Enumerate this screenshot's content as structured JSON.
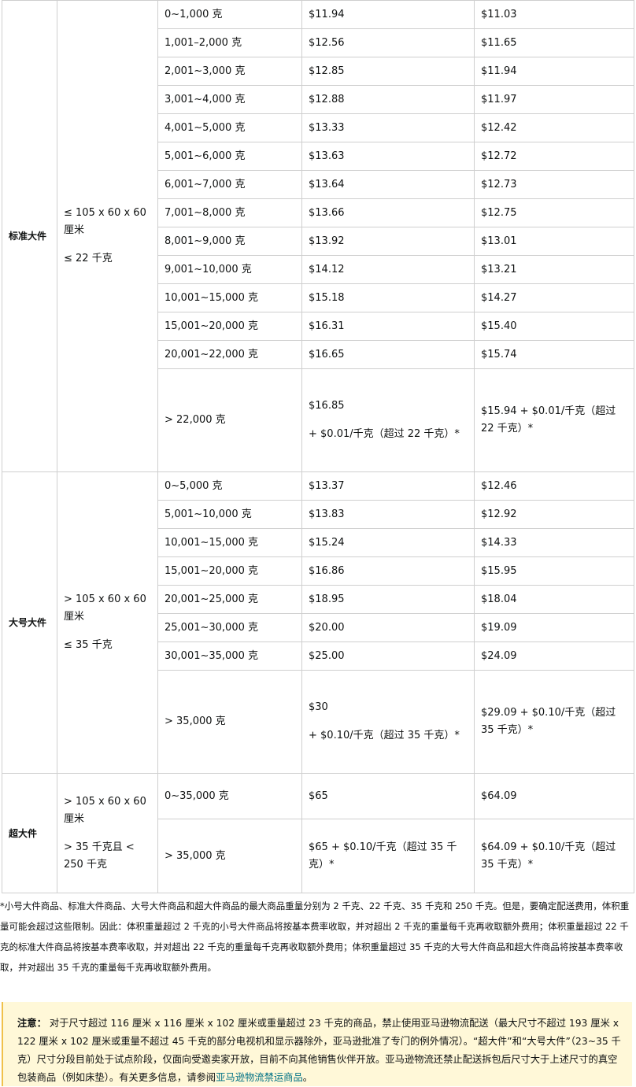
{
  "standard": {
    "tier": "标准大件",
    "dims": "≤ 105 x 60 x 60 厘米",
    "weight_limit": "≤ 22 千克",
    "rows": [
      {
        "w": "0~1,000 克",
        "a": "$11.94",
        "b": "$11.03"
      },
      {
        "w": "1,001–2,000 克",
        "a": "$12.56",
        "b": "$11.65"
      },
      {
        "w": "2,001~3,000 克",
        "a": "$12.85",
        "b": "$11.94"
      },
      {
        "w": "3,001~4,000 克",
        "a": "$12.88",
        "b": "$11.97"
      },
      {
        "w": "4,001~5,000 克",
        "a": "$13.33",
        "b": "$12.42"
      },
      {
        "w": "5,001~6,000 克",
        "a": "$13.63",
        "b": "$12.72"
      },
      {
        "w": "6,001~7,000 克",
        "a": "$13.64",
        "b": "$12.73"
      },
      {
        "w": "7,001~8,000 克",
        "a": "$13.66",
        "b": "$12.75"
      },
      {
        "w": "8,001~9,000 克",
        "a": "$13.92",
        "b": "$13.01"
      },
      {
        "w": "9,001~10,000 克",
        "a": "$14.12",
        "b": "$13.21"
      },
      {
        "w": "10,001~15,000 克",
        "a": "$15.18",
        "b": "$14.27"
      },
      {
        "w": "15,001~20,000 克",
        "a": "$16.31",
        "b": "$15.40"
      },
      {
        "w": "20,001~22,000 克",
        "a": "$16.65",
        "b": "$15.74"
      }
    ],
    "last": {
      "w": "> 22,000 克",
      "a1": "$16.85",
      "a2": "+ $0.01/千克（超过 22 千克）*",
      "b": "$15.94 + $0.01/千克（超过 22 千克）*"
    }
  },
  "large": {
    "tier": "大号大件",
    "dims": "> 105 x 60 x 60 厘米",
    "weight_limit": "≤ 35 千克",
    "rows": [
      {
        "w": "0~5,000 克",
        "a": "$13.37",
        "b": "$12.46"
      },
      {
        "w": "5,001~10,000 克",
        "a": "$13.83",
        "b": "$12.92"
      },
      {
        "w": "10,001~15,000 克",
        "a": "$15.24",
        "b": "$14.33"
      },
      {
        "w": "15,001~20,000 克",
        "a": "$16.86",
        "b": "$15.95"
      },
      {
        "w": "20,001~25,000 克",
        "a": "$18.95",
        "b": "$18.04"
      },
      {
        "w": "25,001~30,000 克",
        "a": "$20.00",
        "b": "$19.09"
      },
      {
        "w": "30,001~35,000 克",
        "a": "$25.00",
        "b": "$24.09"
      }
    ],
    "last": {
      "w": "> 35,000 克",
      "a1": "$30",
      "a2": "+ $0.10/千克（超过 35 千克）*",
      "b": "$29.09 + $0.10/千克（超过 35 千克）*"
    }
  },
  "extra": {
    "tier": "超大件",
    "dims": "> 105 x 60 x 60 厘米",
    "weight_limit": "> 35 千克且 < 250 千克",
    "rows": [
      {
        "w": "0~35,000 克",
        "a": "$65",
        "b": "$64.09"
      },
      {
        "w": "> 35,000 克",
        "a": "$65 + $0.10/千克（超过 35 千克）*",
        "b": "$64.09 + $0.10/千克（超过 35 千克）*"
      }
    ]
  },
  "footnote": "*小号大件商品、标准大件商品、大号大件商品和超大件商品的最大商品重量分别为 2 千克、22 千克、35 千克和 250 千克。但是，要确定配送费用，体积重量可能会超过这些限制。因此：体积重量超过 2 千克的小号大件商品将按基本费率收取，并对超出 2 千克的重量每千克再收取额外费用；体积重量超过 22 千克的标准大件商品将按基本费率收取，并对超出 22 千克的重量每千克再收取额外费用；体积重量超过 35 千克的大号大件商品和超大件商品将按基本费率收取，并对超出 35 千克的重量每千克再收取额外费用。",
  "note": {
    "label": "注意：",
    "text": "对于尺寸超过 116 厘米 x 116 厘米 x 102 厘米或重量超过 23 千克的商品，禁止使用亚马逊物流配送（最大尺寸不超过 193 厘米 x 122 厘米 x 102 厘米或重量不超过 45 千克的部分电视机和显示器除外，亚马逊批准了专门的例外情况）。“超大件”和“大号大件”（23~35 千克）尺寸分段目前处于试点阶段，仅面向受邀卖家开放，目前不向其他销售伙伴开放。亚马逊物流还禁止配送拆包后尺寸大于上述尺寸的真空包装商品（例如床垫）。有关更多信息，请参阅",
    "link": "亚马逊物流禁运商品",
    "end": "。"
  },
  "colors": {
    "border": "#cfcfcf",
    "note_bg": "#fff8d8",
    "link": "#007185"
  }
}
